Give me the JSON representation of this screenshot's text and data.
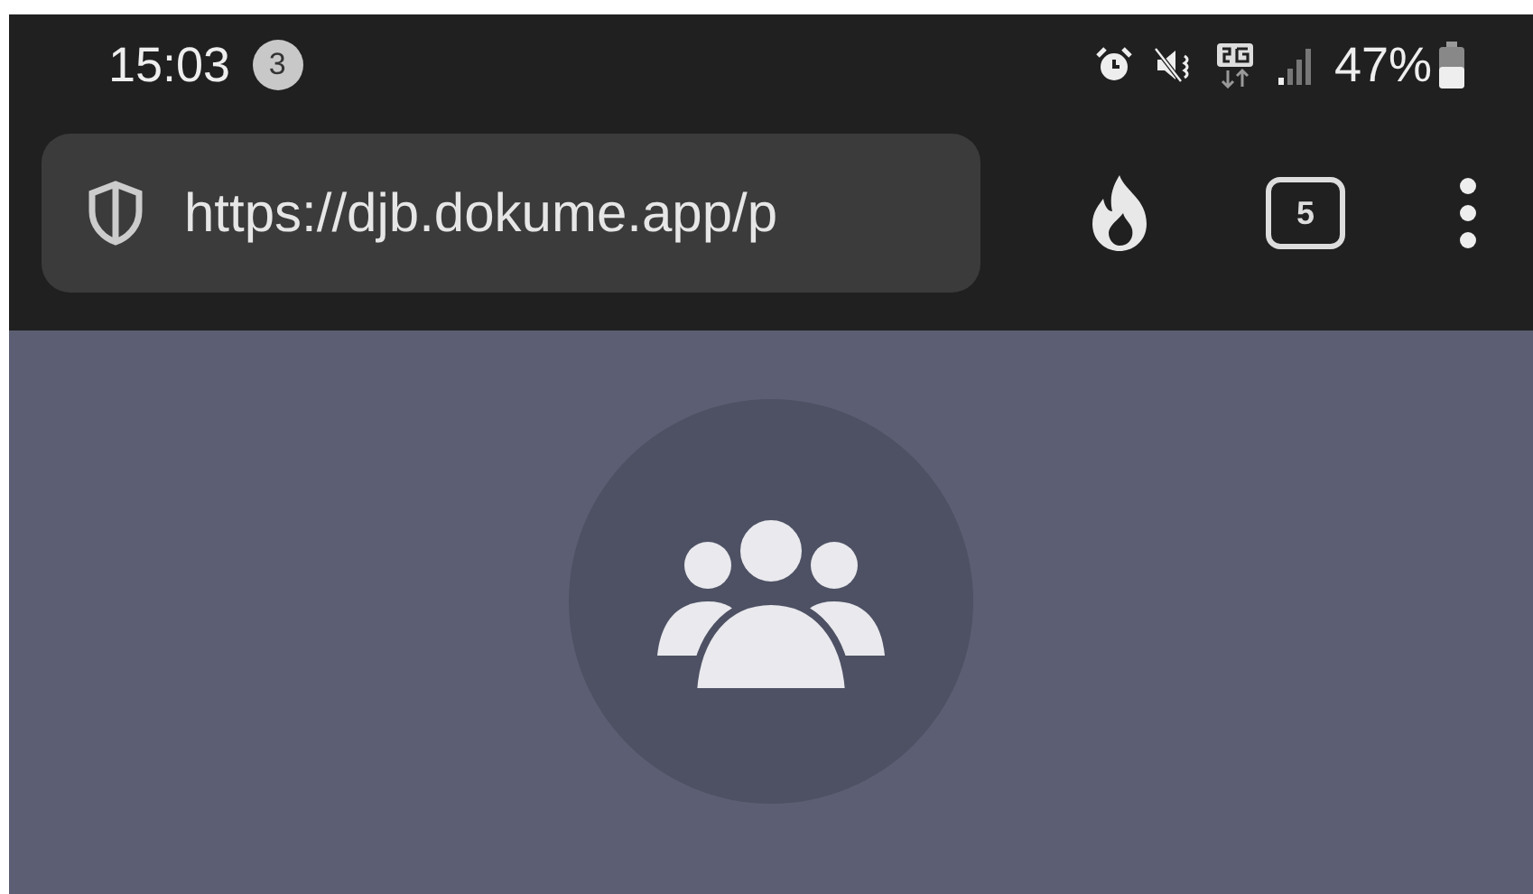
{
  "status_bar": {
    "time": "15:03",
    "notification_count": "3",
    "battery": "47%"
  },
  "browser": {
    "url": "https://djb.dokume.app/p",
    "tab_count": "5"
  },
  "page": {
    "avatar": {
      "kind": "group"
    }
  }
}
